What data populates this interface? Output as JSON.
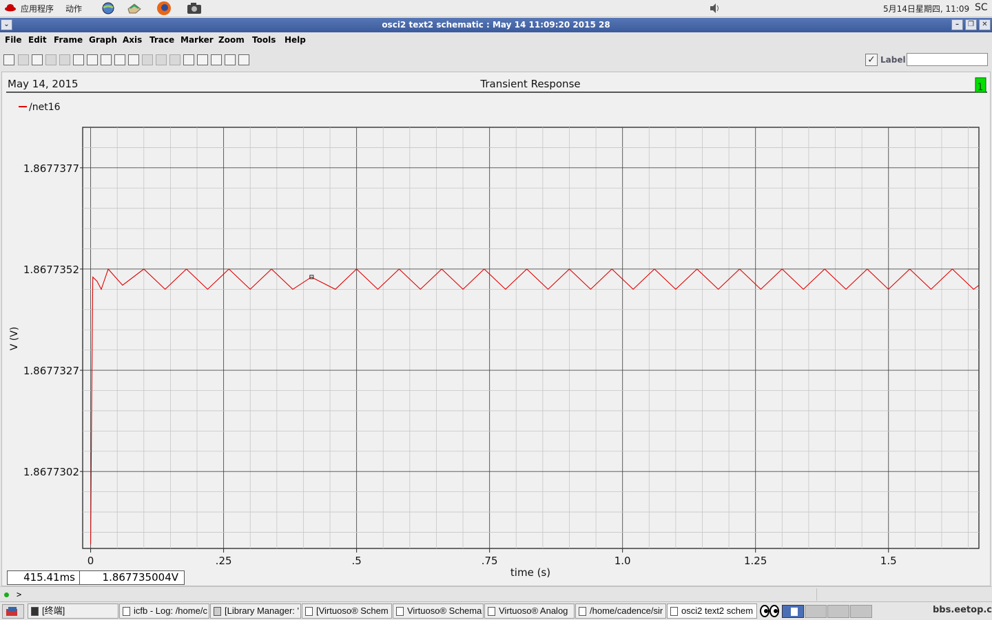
{
  "top_panel": {
    "apps_menu": "应用程序",
    "actions_menu": "动作",
    "clock": "5月14日星期四, 11:09",
    "corner": "SC"
  },
  "window": {
    "title": "osci2 text2 schematic : May 14 11:09:20 2015 28"
  },
  "menu": [
    "File",
    "Edit",
    "Frame",
    "Graph",
    "Axis",
    "Trace",
    "Marker",
    "Zoom",
    "Tools",
    "Help"
  ],
  "toolbar": {
    "label_text": "Label",
    "label_value": ""
  },
  "graph": {
    "date": "May 14, 2015",
    "title": "Transient Response",
    "subwindow": "1",
    "legend_label": "/net16",
    "cursor_x": "415.41ms",
    "cursor_y": "1.867735004V",
    "prompt": ">"
  },
  "chart_data": {
    "type": "line",
    "title": "Transient Response",
    "xlabel": "time (s)",
    "ylabel": "V (V)",
    "x_ticks": [
      "0",
      ".25",
      ".5",
      ".75",
      "1.0",
      "1.25",
      "1.5"
    ],
    "x_tick_values": [
      0,
      0.25,
      0.5,
      0.75,
      1.0,
      1.25,
      1.5
    ],
    "y_ticks": [
      "1.8677377",
      "1.8677352",
      "1.8677327",
      "1.8677302"
    ],
    "y_tick_values": [
      1.8677377,
      1.8677352,
      1.8677327,
      1.8677302
    ],
    "xlim": [
      -0.015,
      1.67
    ],
    "ylim": [
      1.8677283,
      1.8677387
    ],
    "grid": true,
    "legend_position": "top-left",
    "series": [
      {
        "name": "/net16",
        "color": "#e00000",
        "x": [
          0.0,
          0.002,
          0.004,
          0.012,
          0.02,
          0.033,
          0.06,
          0.1,
          0.14,
          0.18,
          0.22,
          0.26,
          0.3,
          0.34,
          0.38,
          0.415,
          0.46,
          0.5,
          0.54,
          0.58,
          0.62,
          0.66,
          0.7,
          0.74,
          0.78,
          0.82,
          0.86,
          0.9,
          0.94,
          0.98,
          1.02,
          1.06,
          1.1,
          1.14,
          1.18,
          1.22,
          1.26,
          1.3,
          1.34,
          1.38,
          1.42,
          1.46,
          1.5,
          1.54,
          1.58,
          1.62,
          1.66,
          1.67
        ],
        "y": [
          1.8677284,
          1.867732,
          1.867735,
          1.8677349,
          1.8677347,
          1.8677352,
          1.8677348,
          1.8677352,
          1.8677347,
          1.8677352,
          1.8677347,
          1.8677352,
          1.8677347,
          1.8677352,
          1.8677347,
          1.867735,
          1.8677347,
          1.8677352,
          1.8677347,
          1.8677352,
          1.8677347,
          1.8677352,
          1.8677347,
          1.8677352,
          1.8677347,
          1.8677352,
          1.8677347,
          1.8677352,
          1.8677347,
          1.8677352,
          1.8677347,
          1.8677352,
          1.8677347,
          1.8677352,
          1.8677347,
          1.8677352,
          1.8677347,
          1.8677352,
          1.8677347,
          1.8677352,
          1.8677347,
          1.8677352,
          1.8677347,
          1.8677352,
          1.8677347,
          1.8677352,
          1.8677347,
          1.8677348
        ]
      }
    ],
    "marker": {
      "x": 0.41541,
      "y": 1.867735004
    }
  },
  "taskbar": {
    "items": [
      "[终端]",
      "icfb - Log: /home/c",
      "[Library Manager: '",
      "[Virtuoso® Schem",
      "Virtuoso® Schema",
      "Virtuoso® Analog",
      "/home/cadence/sir",
      "osci2 text2 schem"
    ],
    "watermark": "bbs.eetop.cn"
  }
}
